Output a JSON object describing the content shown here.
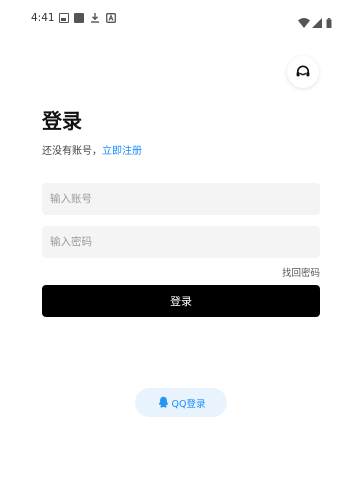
{
  "status_bar": {
    "time": "4:41",
    "icons": [
      "photo-icon",
      "square-icon",
      "download-icon",
      "app-icon",
      "wifi-icon",
      "signal-icon",
      "battery-icon"
    ]
  },
  "header": {
    "support_icon": "headset-icon"
  },
  "login": {
    "title": "登录",
    "no_account_text": "还没有账号，",
    "register_link": "立即注册",
    "account_placeholder": "输入账号",
    "password_placeholder": "输入密码",
    "forgot_password": "找回密码",
    "login_button": "登录",
    "qq_login": "QQ登录"
  },
  "colors": {
    "accent": "#1a8cff",
    "button_bg": "#000000",
    "input_bg": "#f4f4f4",
    "qq_bg": "#e8f3fd"
  }
}
